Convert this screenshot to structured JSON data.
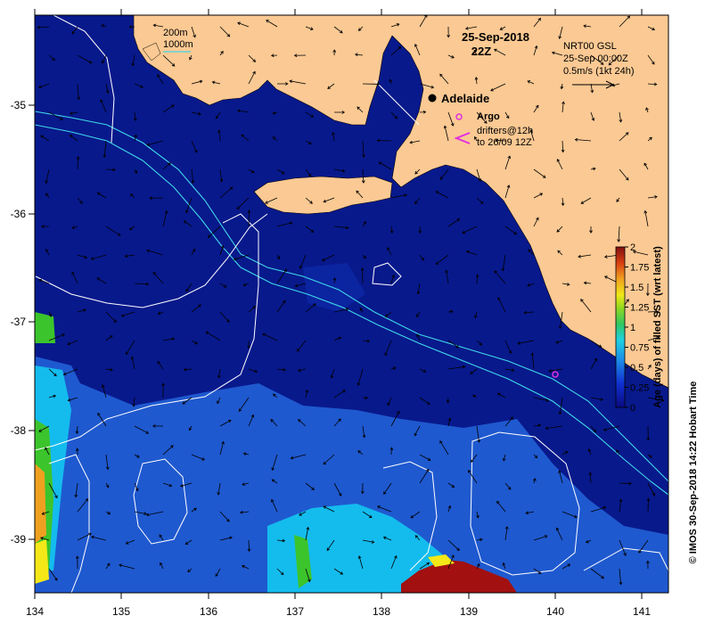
{
  "title": {
    "date": "25-Sep-2018",
    "time": "22Z"
  },
  "isobath_legend": {
    "line1": "200m",
    "line2": "1000m"
  },
  "current_legend": {
    "line1": "NRT00 GSL",
    "line2": "25-Sep 00:00Z",
    "line3": "0.5m/s (1kt 24h)"
  },
  "places": {
    "city": "Adelaide"
  },
  "symbols_legend": {
    "argo": "Argo",
    "drifters_line1": "drifters@12h",
    "drifters_line2": "to 26/09 12Z"
  },
  "colorbar": {
    "label": "Age (days) of filled SST (wrt latest)",
    "ticks": [
      "2",
      "1.75",
      "1.5",
      "1.25",
      "1",
      "0.75",
      "0.5",
      "0.25",
      "0"
    ]
  },
  "credit": "© IMOS 30-Sep-2018 14:22 Hobart Time",
  "axes": {
    "x_ticks": [
      "134",
      "135",
      "136",
      "137",
      "138",
      "139",
      "140",
      "141"
    ],
    "y_ticks": [
      "-35",
      "-36",
      "-37",
      "-38",
      "-39"
    ]
  },
  "colors": {
    "land": "#fbc993",
    "ocean_deep": "#08198c",
    "ocean_mid": "#1f59cf",
    "ocean_light": "#14bcee",
    "green": "#3cc42c",
    "yellow": "#f4e818",
    "orange": "#f0a020",
    "dark_red": "#a21010",
    "isobath": "#40d8e8",
    "contour": "#ffffff",
    "argo": "#e030e0"
  }
}
